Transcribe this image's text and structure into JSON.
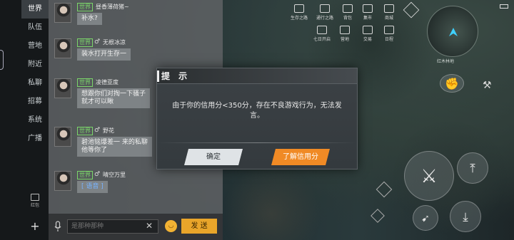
{
  "channels": [
    {
      "label": "世界",
      "active": true
    },
    {
      "label": "队伍",
      "active": false
    },
    {
      "label": "营地",
      "active": false
    },
    {
      "label": "附近",
      "active": false
    },
    {
      "label": "私聊",
      "active": false
    },
    {
      "label": "招募",
      "active": false
    },
    {
      "label": "系统",
      "active": false
    },
    {
      "label": "广播",
      "active": false
    }
  ],
  "red_packet_label": "红包",
  "messages": [
    {
      "tag": "世界",
      "sender": "昼香薄荷猪~",
      "text": "补水?",
      "gender": ""
    },
    {
      "tag": "世界",
      "sender": "无根冰凉",
      "text": "装水打开生存一",
      "gender": "♂"
    },
    {
      "tag": "世界",
      "sender": "凌德亚度",
      "text": "想跟你们对掏一下骚子\n就才可以瞅",
      "gender": ""
    },
    {
      "tag": "世界",
      "sender": "野花",
      "text": "碧池铭爆差一 来的私聊\n他等你了",
      "gender": "♂"
    },
    {
      "tag": "世界",
      "sender": "晴空万里",
      "text": "[ 语音 ]",
      "gender": "♂"
    }
  ],
  "input": {
    "placeholder": "是那种那种"
  },
  "send_label": "发 送",
  "hud_top": [
    {
      "label": "生存之路"
    },
    {
      "label": "通行之路"
    },
    {
      "label": "背包"
    },
    {
      "label": "集市"
    },
    {
      "label": "商城"
    },
    {
      "label": "七日开启"
    },
    {
      "label": "营地"
    },
    {
      "label": "交易"
    },
    {
      "label": "日程"
    }
  ],
  "minimap_label": "红木林地",
  "dialog": {
    "title": "提 示",
    "message": "由于你的信用分<350分，存在不良游戏行为，无法发言。",
    "confirm_label": "确定",
    "learn_label": "了解信用分"
  },
  "colors": {
    "accent_orange": "#f08a25",
    "world_tag_green": "#7bd66a",
    "send_yellow": "#e9a52a"
  }
}
